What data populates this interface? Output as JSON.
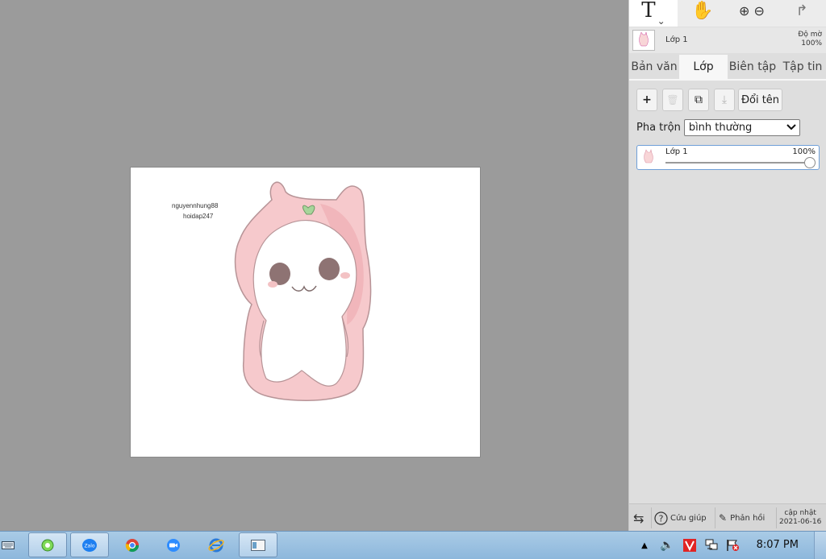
{
  "workspace": {
    "canvas": {
      "signature_line1": "nguyennhung88",
      "signature_line2": "hoidap247"
    }
  },
  "panel": {
    "tools": [
      {
        "name": "text-tool",
        "glyph": "T",
        "sub": "⌄"
      },
      {
        "name": "hand-tool",
        "glyph": "✋"
      },
      {
        "name": "zoom-tool",
        "glyph": "⊕ ⊖"
      },
      {
        "name": "redo-tool",
        "glyph": "↱"
      }
    ],
    "current_layer": {
      "name": "Lớp 1",
      "opacity_label": "Độ mờ",
      "opacity_value": "100%"
    },
    "tabs": [
      "Bản văn",
      "Lớp",
      "Biên tập",
      "Tập tin"
    ],
    "active_tab": 1,
    "layer_actions": {
      "add": "+",
      "delete": "🗑",
      "duplicate": "⧉",
      "merge": "⤓",
      "rename": "Đổi tên"
    },
    "blend": {
      "label": "Pha trộn",
      "value": "bình thường"
    },
    "layers": [
      {
        "name": "Lớp 1",
        "opacity": "100%",
        "opacity_fraction": 1.0
      }
    ],
    "footer": {
      "swap_icon": "⇆",
      "help": "Cứu giúp",
      "feedback": "Phản hồi",
      "update_label": "cập nhật",
      "update_date": "2021-06-16"
    }
  },
  "taskbar": {
    "clock": "8:07 PM",
    "apps": [
      "keyboard",
      "app-green",
      "zalo",
      "chrome",
      "zoom",
      "internet-explorer",
      "window"
    ],
    "zalo_label": "Zalo"
  }
}
